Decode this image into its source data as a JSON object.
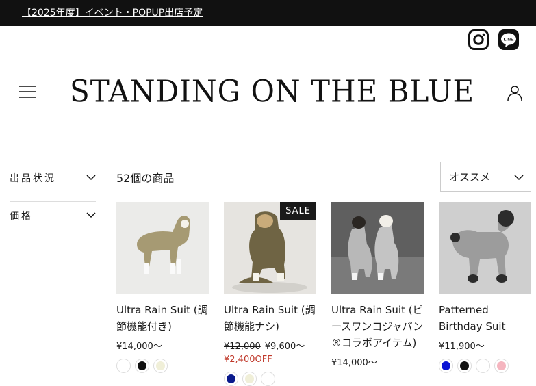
{
  "announcement": {
    "text": "【2025年度】イベント・POPUP出店予定"
  },
  "social": {
    "icons": [
      "instagram-icon",
      "line-icon"
    ],
    "line_label": "LINE"
  },
  "header": {
    "logo_text": "STANDING ON THE BLUE"
  },
  "filters": [
    {
      "label": "出品状況"
    },
    {
      "label": "価格"
    }
  ],
  "listing": {
    "count_label": "52個の商品",
    "sort_label": "オススメ"
  },
  "products": [
    {
      "title": "Ultra Rain Suit (調節機能付き)",
      "price": "¥14,000〜",
      "old_price": "",
      "sale_badge": "",
      "discount": "",
      "swatches": [
        "#ffffff",
        "#111111",
        "#f0efd8"
      ]
    },
    {
      "title": "Ultra Rain Suit (調節機能ナシ)",
      "price": "¥9,600〜",
      "old_price": "¥12,000",
      "sale_badge": "SALE",
      "discount": "¥2,400OFF",
      "swatches": [
        "#0a1a8c",
        "#f0efd8",
        "#ffffff"
      ]
    },
    {
      "title": "Ultra Rain Suit (ピースワンコジャパン®コラボアイテム)",
      "price": "¥14,000〜",
      "old_price": "",
      "sale_badge": "",
      "discount": "",
      "swatches": []
    },
    {
      "title": "Patterned Birthday Suit",
      "price": "¥11,900〜",
      "old_price": "",
      "sale_badge": "",
      "discount": "",
      "swatches": [
        "#0a14d4",
        "#111111",
        "#ffffff",
        "#f5b5bf"
      ]
    }
  ]
}
